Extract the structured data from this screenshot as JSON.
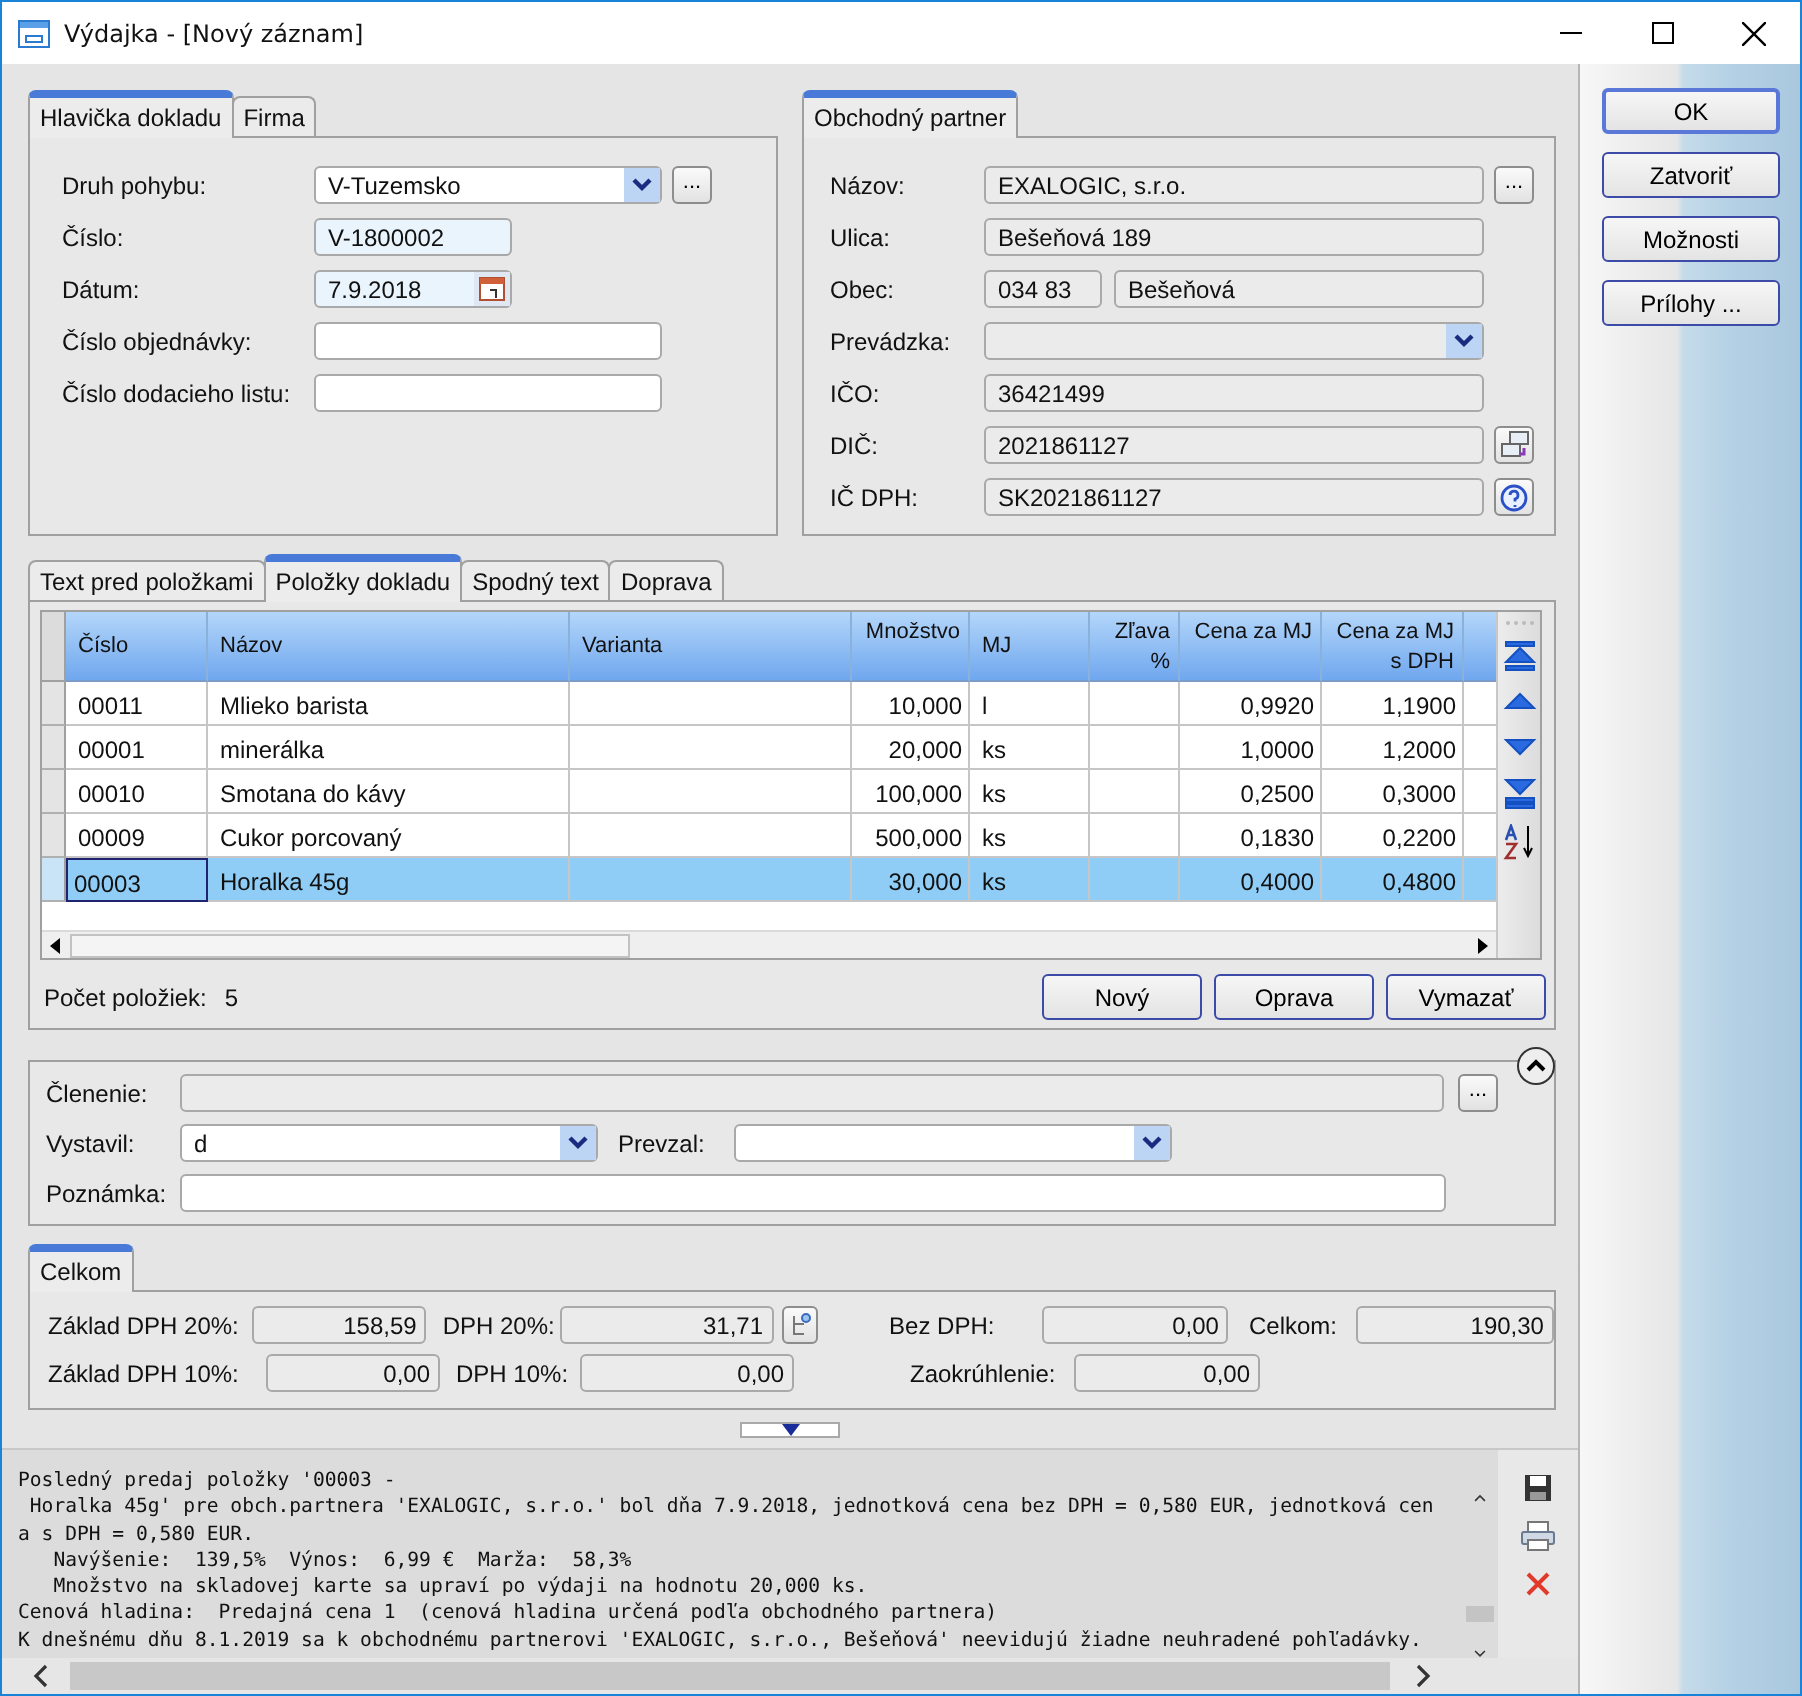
{
  "window": {
    "title": "Výdajka - [Nový záznam]"
  },
  "header": {
    "tabs": [
      {
        "label": "Hlavička dokladu",
        "selected": true
      },
      {
        "label": "Firma",
        "selected": false
      }
    ],
    "fields": [
      {
        "label": "Druh pohybu:",
        "kind": "combo",
        "value": "V-Tuzemsko",
        "button": "...",
        "highlighted": false
      },
      {
        "label": "Číslo:",
        "kind": "text",
        "value": "V-1800002",
        "highlighted": true
      },
      {
        "label": "Dátum:",
        "kind": "date",
        "value": "7.9.2018",
        "highlighted": true
      },
      {
        "label": "Číslo objednávky:",
        "kind": "text",
        "highlighted": false
      },
      {
        "label": "Číslo dodacieho listu:",
        "kind": "text",
        "highlighted": false
      }
    ]
  },
  "partner": {
    "tabs": [
      {
        "label": "Obchodný partner",
        "selected": true
      }
    ],
    "fields": [
      {
        "label": "Názov:",
        "kind": "readonly",
        "value": "EXALOGIC, s.r.o.",
        "button": "..."
      },
      {
        "label": "Ulica:",
        "kind": "readonly",
        "value": "Bešeňová 189"
      },
      {
        "label": "Obec:",
        "kind": "split",
        "values": [
          "034 83",
          "Bešeňová"
        ]
      },
      {
        "label": "Prevádzka:",
        "kind": "combo"
      },
      {
        "label": "IČO:",
        "kind": "readonly",
        "value": "36421499"
      },
      {
        "label": "DIČ:",
        "kind": "copy",
        "value": "2021861127"
      },
      {
        "label": "IČ DPH:",
        "kind": "help",
        "value": "SK2021861127"
      }
    ]
  },
  "actions": [
    {
      "label": "OK",
      "default": true
    },
    {
      "label": "Zatvoriť",
      "default": false
    },
    {
      "label": "Možnosti",
      "default": false
    },
    {
      "label": "Prílohy ...",
      "default": false
    }
  ],
  "items": {
    "tabs": [
      {
        "label": "Text pred položkami",
        "selected": false
      },
      {
        "label": "Položky dokladu",
        "selected": true
      },
      {
        "label": "Spodný text",
        "selected": false
      },
      {
        "label": "Doprava",
        "selected": false
      }
    ],
    "columns": [
      {
        "label": "Číslo",
        "kind": "text"
      },
      {
        "label": "Názov",
        "kind": "text"
      },
      {
        "label": "Varianta",
        "kind": "text"
      },
      {
        "label": "Množstvo",
        "kind": "number"
      },
      {
        "label": "MJ",
        "kind": "text"
      },
      {
        "label": "Zľava %",
        "kind": "number"
      },
      {
        "label": "Cena za MJ",
        "kind": "number"
      },
      {
        "label": "Cena za MJ s DPH",
        "kind": "number"
      }
    ],
    "rows": [
      {
        "cells": [
          "00011",
          "Mlieko barista",
          "",
          "10,000",
          "l",
          "",
          "0,9920",
          "1,1900"
        ],
        "selected": false
      },
      {
        "cells": [
          "00001",
          "minerálka",
          "",
          "20,000",
          "ks",
          "",
          "1,0000",
          "1,2000"
        ],
        "selected": false
      },
      {
        "cells": [
          "00010",
          "Smotana do kávy",
          "",
          "100,000",
          "ks",
          "",
          "0,2500",
          "0,3000"
        ],
        "selected": false
      },
      {
        "cells": [
          "00009",
          "Cukor porcovaný",
          "",
          "500,000",
          "ks",
          "",
          "0,1830",
          "0,2200"
        ],
        "selected": false
      },
      {
        "cells": [
          "00003",
          "Horalka 45g",
          "",
          "30,000",
          "ks",
          "",
          "0,4000",
          "0,4800"
        ],
        "selected": true
      }
    ],
    "count_label": "Počet položiek:",
    "count": "5",
    "buttons": [
      "Nový",
      "Oprava",
      "Vymazať"
    ]
  },
  "details": {
    "rows": [
      [
        {
          "label": "Členenie:",
          "kind": "readonly",
          "button": "..."
        }
      ],
      [
        {
          "label": "Vystavil:",
          "kind": "combo",
          "value": "d"
        },
        {
          "label": "Prevzal:",
          "kind": "combo"
        }
      ],
      [
        {
          "label": "Poznámka:",
          "kind": "text"
        }
      ]
    ]
  },
  "totals": {
    "tabs": [
      {
        "label": "Celkom",
        "selected": true
      }
    ],
    "rows": [
      [
        {
          "label": "Základ DPH 20%:",
          "value": "158,59",
          "kind": "plain"
        },
        {
          "label": "DPH 20%:",
          "value": "31,71",
          "kind": "button"
        },
        {
          "label": "Bez DPH:",
          "value": "0,00",
          "kind": "plain"
        },
        {
          "label": "Celkom:",
          "value": "190,30",
          "kind": "plain"
        }
      ],
      [
        {
          "label": "Základ DPH 10%:",
          "value": "0,00",
          "kind": "plain"
        },
        {
          "label": "DPH 10%:",
          "value": "0,00",
          "kind": "plain"
        },
        {
          "label": "Zaokrúhlenie:",
          "value": "0,00",
          "kind": "plain"
        }
      ]
    ]
  },
  "log": {
    "lines": [
      "Posledný predaj položky '00003 -",
      " Horalka 45g' pre obch.partnera 'EXALOGIC, s.r.o.' bol dňa 7.9.2018, jednotková cena bez DPH = 0,580 EUR, jednotková cen",
      "a s DPH = 0,580 EUR.",
      "   Navýšenie:  139,5%  Výnos:  6,99 €  Marža:  58,3%",
      "   Množstvo na skladovej karte sa upraví po výdaji na hodnotu 20,000 ks.",
      "Cenová hladina:  Predajná cena 1  (cenová hladina určená podľa obchodného partnera)",
      "K dnešnému dňu 8.1.2019 sa k obchodnému partnerovi 'EXALOGIC, s.r.o., Bešeňová' neevidujú žiadne neuhradené pohľadávky."
    ]
  }
}
